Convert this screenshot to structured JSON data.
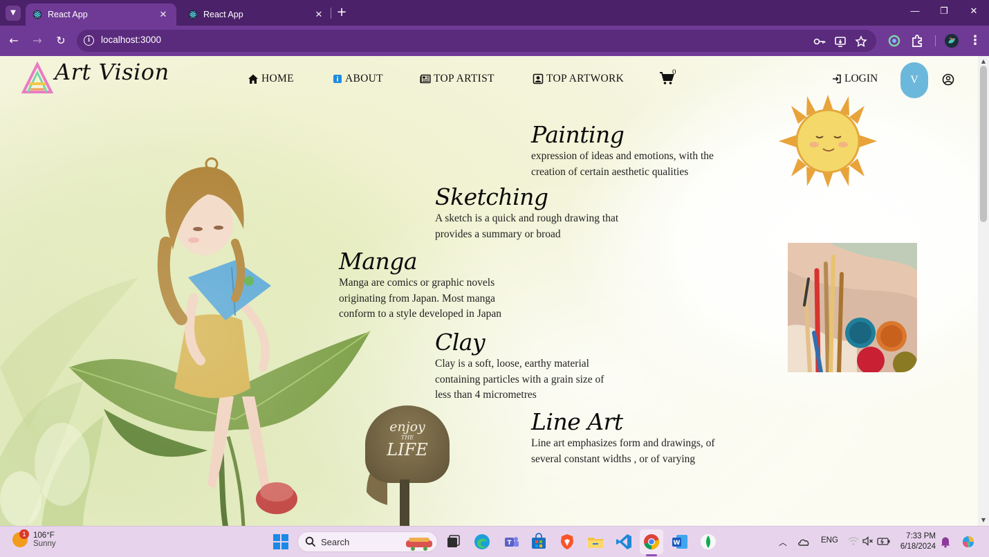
{
  "browser": {
    "tabs": [
      {
        "title": "React App",
        "active": true
      },
      {
        "title": "React App",
        "active": false
      }
    ],
    "url": "localhost:3000"
  },
  "site": {
    "brand": "Art Vision",
    "nav": {
      "home": "HOME",
      "about": "ABOUT",
      "top_artist": "TOP ARTIST",
      "top_artwork": "TOP ARTWORK",
      "cart_count": "0",
      "login": "LOGIN",
      "avatar_initial": "V"
    },
    "categories": [
      {
        "title": "Painting",
        "desc": [
          "expression of ideas and emotions, with the",
          "creation of certain aesthetic qualities"
        ]
      },
      {
        "title": "Sketching",
        "desc": [
          "A sketch is a quick and rough drawing that",
          "provides a summary or broad"
        ]
      },
      {
        "title": "Manga",
        "desc": [
          "Manga are comics or graphic novels",
          "originating from Japan. Most manga",
          "conform to a style developed in Japan"
        ]
      },
      {
        "title": "Clay",
        "desc": [
          "Clay is a soft, loose, earthy material",
          "containing particles with a grain size of",
          "less than 4 micrometres"
        ]
      },
      {
        "title": "Line Art",
        "desc": [
          "Line art emphasizes form and drawings, of",
          "several constant widths , or of varying"
        ]
      }
    ],
    "sign_text": [
      "enjoy",
      "THE",
      "LIFE"
    ]
  },
  "taskbar": {
    "weather_temp": "106°F",
    "weather_desc": "Sunny",
    "weather_badge": "1",
    "search_placeholder": "Search",
    "lang": "ENG",
    "time": "7:33 PM",
    "date": "6/18/2024"
  },
  "colors": {
    "chrome_dark": "#4b2169",
    "chrome": "#6f3a95",
    "avatar": "#6cb8dc",
    "taskbar": "#e7d4ec"
  }
}
